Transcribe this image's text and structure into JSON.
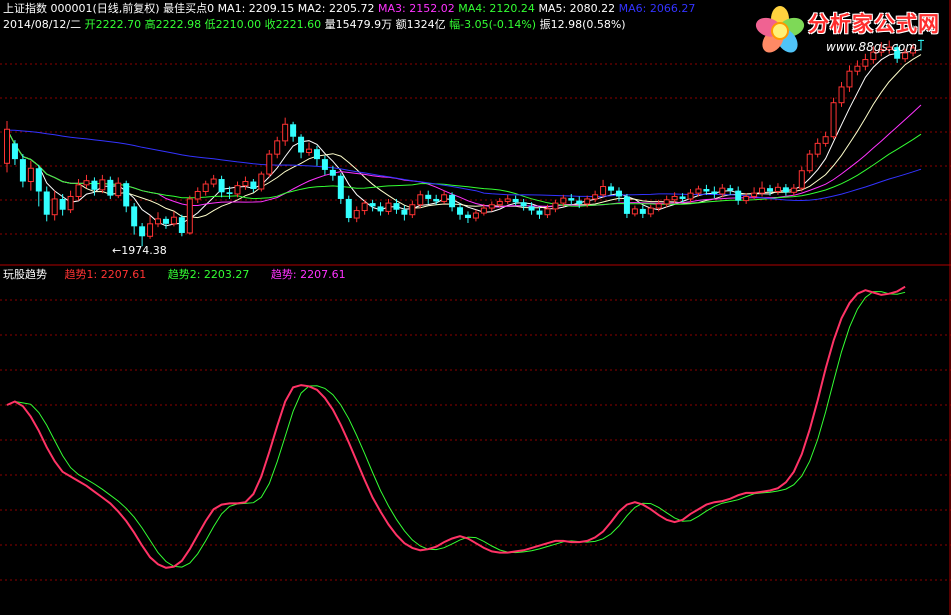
{
  "header": {
    "line1": [
      {
        "text": "上证指数 000001(日线,前复权) 最佳买点0",
        "color": "#ffffff"
      },
      {
        "text": "MA1: 2209.15",
        "color": "#ffffff"
      },
      {
        "text": "MA2: 2205.72",
        "color": "#ffffff"
      },
      {
        "text": "MA3: 2152.02",
        "color": "#ff33ff"
      },
      {
        "text": "MA4: 2120.24",
        "color": "#33ff33"
      },
      {
        "text": "MA5: 2080.22",
        "color": "#ffffff"
      },
      {
        "text": "MA6: 2066.27",
        "color": "#3333ff"
      }
    ],
    "line2": [
      {
        "text": "2014/08/12/二",
        "color": "#ffffff"
      },
      {
        "text": "开2222.70",
        "color": "#33ff33"
      },
      {
        "text": "高2222.98",
        "color": "#33ff33"
      },
      {
        "text": "低2210.00",
        "color": "#33ff33"
      },
      {
        "text": "收2221.60",
        "color": "#33ff33"
      },
      {
        "text": "量15479.9万",
        "color": "#ffffff"
      },
      {
        "text": "额1324亿",
        "color": "#ffffff"
      },
      {
        "text": "幅-3.05(-0.14%)",
        "color": "#33ff33"
      },
      {
        "text": "振12.98(0.58%)",
        "color": "#ffffff"
      }
    ]
  },
  "low_label": "1974.38",
  "indicator": {
    "name": "玩股趋势",
    "labels": [
      {
        "text": "趋势1: 2207.61",
        "color": "#ff3333"
      },
      {
        "text": "趋势2: 2203.27",
        "color": "#33ff33"
      },
      {
        "text": "趋势: 2207.61",
        "color": "#ff33ff"
      }
    ]
  },
  "logo": {
    "title": "分析家公式网",
    "url": "www.88gs.com"
  },
  "colors": {
    "up": "#ff3333",
    "down": "#33ffff",
    "grid": "#8b0000",
    "divider": "#b00000"
  },
  "chart_data": {
    "type": "candlestick",
    "price_range": [
      1955,
      2225
    ],
    "candles": [
      [
        2074,
        2115,
        2125,
        2063
      ],
      [
        2098,
        2079,
        2102,
        2072
      ],
      [
        2079,
        2052,
        2085,
        2045
      ],
      [
        2052,
        2068,
        2077,
        2041
      ],
      [
        2068,
        2040,
        2072,
        2022
      ],
      [
        2040,
        2012,
        2046,
        2004
      ],
      [
        2012,
        2031,
        2041,
        2005
      ],
      [
        2031,
        2018,
        2037,
        2011
      ],
      [
        2018,
        2034,
        2041,
        2014
      ],
      [
        2034,
        2048,
        2055,
        2029
      ],
      [
        2048,
        2053,
        2060,
        2044
      ],
      [
        2053,
        2042,
        2057,
        2035
      ],
      [
        2042,
        2054,
        2060,
        2038
      ],
      [
        2054,
        2035,
        2058,
        2031
      ],
      [
        2035,
        2050,
        2057,
        2032
      ],
      [
        2050,
        2022,
        2053,
        2015
      ],
      [
        2022,
        1998,
        2026,
        1988
      ],
      [
        1998,
        1986,
        2002,
        1974
      ],
      [
        1986,
        2001,
        2011,
        1983
      ],
      [
        2001,
        2007,
        2015,
        1997
      ],
      [
        2007,
        2001,
        2010,
        1995
      ],
      [
        2001,
        2009,
        2016,
        1998
      ],
      [
        2009,
        1990,
        2012,
        1986
      ],
      [
        1990,
        2031,
        2035,
        1988
      ],
      [
        2031,
        2040,
        2045,
        2026
      ],
      [
        2040,
        2049,
        2053,
        2035
      ],
      [
        2049,
        2055,
        2060,
        2045
      ],
      [
        2055,
        2039,
        2059,
        2033
      ],
      [
        2039,
        2037,
        2046,
        2031
      ],
      [
        2037,
        2047,
        2052,
        2033
      ],
      [
        2047,
        2052,
        2058,
        2042
      ],
      [
        2052,
        2043,
        2055,
        2039
      ],
      [
        2043,
        2061,
        2064,
        2040
      ],
      [
        2061,
        2085,
        2090,
        2057
      ],
      [
        2085,
        2101,
        2106,
        2080
      ],
      [
        2101,
        2121,
        2129,
        2095
      ],
      [
        2121,
        2106,
        2124,
        2100
      ],
      [
        2106,
        2087,
        2109,
        2080
      ],
      [
        2087,
        2091,
        2099,
        2083
      ],
      [
        2091,
        2079,
        2095,
        2071
      ],
      [
        2079,
        2066,
        2083,
        2060
      ],
      [
        2066,
        2059,
        2071,
        2053
      ],
      [
        2059,
        2031,
        2062,
        2025
      ],
      [
        2031,
        2008,
        2035,
        2003
      ],
      [
        2008,
        2017,
        2022,
        2003
      ],
      [
        2017,
        2026,
        2030,
        2012
      ],
      [
        2026,
        2022,
        2030,
        2016
      ],
      [
        2022,
        2016,
        2027,
        2011
      ],
      [
        2016,
        2026,
        2031,
        2012
      ],
      [
        2026,
        2018,
        2031,
        2013
      ],
      [
        2018,
        2012,
        2023,
        2005
      ],
      [
        2012,
        2024,
        2029,
        2008
      ],
      [
        2024,
        2036,
        2041,
        2020
      ],
      [
        2036,
        2031,
        2041,
        2025
      ],
      [
        2031,
        2028,
        2036,
        2024
      ],
      [
        2028,
        2036,
        2041,
        2025
      ],
      [
        2036,
        2021,
        2039,
        2016
      ],
      [
        2021,
        2012,
        2025,
        2006
      ],
      [
        2012,
        2008,
        2016,
        2002
      ],
      [
        2008,
        2014,
        2018,
        2004
      ],
      [
        2014,
        2020,
        2025,
        2011
      ],
      [
        2020,
        2024,
        2028,
        2016
      ],
      [
        2024,
        2028,
        2032,
        2021
      ],
      [
        2028,
        2031,
        2036,
        2025
      ],
      [
        2031,
        2027,
        2035,
        2023
      ],
      [
        2027,
        2022,
        2031,
        2017
      ],
      [
        2022,
        2017,
        2027,
        2012
      ],
      [
        2017,
        2012,
        2021,
        2007
      ],
      [
        2012,
        2019,
        2024,
        2008
      ],
      [
        2019,
        2026,
        2030,
        2015
      ],
      [
        2026,
        2032,
        2036,
        2022
      ],
      [
        2032,
        2029,
        2037,
        2024
      ],
      [
        2029,
        2025,
        2034,
        2020
      ],
      [
        2025,
        2031,
        2035,
        2021
      ],
      [
        2031,
        2036,
        2041,
        2027
      ],
      [
        2036,
        2046,
        2054,
        2033
      ],
      [
        2046,
        2041,
        2050,
        2036
      ],
      [
        2041,
        2034,
        2045,
        2028
      ],
      [
        2034,
        2013,
        2037,
        2008
      ],
      [
        2013,
        2019,
        2023,
        2010
      ],
      [
        2019,
        2013,
        2023,
        2008
      ],
      [
        2013,
        2020,
        2024,
        2009
      ],
      [
        2020,
        2025,
        2030,
        2016
      ],
      [
        2025,
        2030,
        2035,
        2021
      ],
      [
        2030,
        2034,
        2039,
        2026
      ],
      [
        2034,
        2031,
        2038,
        2027
      ],
      [
        2031,
        2038,
        2043,
        2027
      ],
      [
        2038,
        2043,
        2047,
        2034
      ],
      [
        2043,
        2040,
        2048,
        2036
      ],
      [
        2040,
        2037,
        2046,
        2032
      ],
      [
        2037,
        2044,
        2049,
        2033
      ],
      [
        2044,
        2041,
        2048,
        2036
      ],
      [
        2041,
        2029,
        2046,
        2024
      ],
      [
        2029,
        2034,
        2038,
        2025
      ],
      [
        2034,
        2038,
        2045,
        2031
      ],
      [
        2038,
        2044,
        2052,
        2034
      ],
      [
        2044,
        2040,
        2048,
        2035
      ],
      [
        2040,
        2045,
        2050,
        2036
      ],
      [
        2045,
        2039,
        2049,
        2035
      ],
      [
        2039,
        2044,
        2049,
        2035
      ],
      [
        2044,
        2065,
        2070,
        2040
      ],
      [
        2065,
        2085,
        2090,
        2062
      ],
      [
        2085,
        2098,
        2104,
        2081
      ],
      [
        2098,
        2106,
        2112,
        2094
      ],
      [
        2106,
        2147,
        2153,
        2103
      ],
      [
        2147,
        2166,
        2172,
        2142
      ],
      [
        2166,
        2185,
        2192,
        2160
      ],
      [
        2185,
        2191,
        2198,
        2180
      ],
      [
        2191,
        2199,
        2206,
        2186
      ],
      [
        2199,
        2208,
        2215,
        2194
      ],
      [
        2208,
        2211,
        2220,
        2203
      ],
      [
        2211,
        2214,
        2222,
        2206
      ],
      [
        2214,
        2200,
        2218,
        2195
      ],
      [
        2200,
        2207,
        2212,
        2196
      ],
      [
        2207,
        2213,
        2218,
        2203
      ],
      [
        2222.7,
        2221.6,
        2222.98,
        2210.0
      ]
    ],
    "ma": [
      {
        "name": "MA1",
        "period": 5,
        "color": "#ffffff"
      },
      {
        "name": "MA2",
        "period": 10,
        "color": "#ffffcc"
      },
      {
        "name": "MA3",
        "period": 20,
        "color": "#ff33ff"
      },
      {
        "name": "MA4",
        "period": 30,
        "color": "#33ff33"
      },
      {
        "name": "MA6",
        "period": 60,
        "color": "#3333ff"
      }
    ],
    "ma6_start": 2114,
    "low_point": 1974.38,
    "indicator_range": [
      1950,
      2230
    ],
    "trend1": [
      2125,
      2128,
      2124,
      2115,
      2103,
      2089,
      2077,
      2068,
      2064,
      2060,
      2056,
      2051,
      2046,
      2041,
      2034,
      2026,
      2016,
      2005,
      1995,
      1989,
      1986,
      1987,
      1992,
      2002,
      2014,
      2026,
      2036,
      2040,
      2041,
      2041,
      2042,
      2049,
      2064,
      2085,
      2107,
      2128,
      2140,
      2142,
      2141,
      2138,
      2131,
      2121,
      2108,
      2093,
      2077,
      2061,
      2046,
      2034,
      2023,
      2014,
      2007,
      2003,
      2001,
      2002,
      2004,
      2008,
      2011,
      2013,
      2011,
      2007,
      2003,
      2000,
      1999,
      1999,
      2000,
      2001,
      2003,
      2005,
      2007,
      2009,
      2009,
      2008,
      2008,
      2009,
      2012,
      2017,
      2025,
      2034,
      2040,
      2042,
      2040,
      2036,
      2031,
      2027,
      2025,
      2027,
      2032,
      2036,
      2040,
      2042,
      2043,
      2045,
      2048,
      2050,
      2050,
      2051,
      2052,
      2054,
      2059,
      2068,
      2083,
      2104,
      2129,
      2156,
      2180,
      2199,
      2212,
      2220,
      2223,
      2221,
      2219,
      2220,
      2222,
      2226
    ]
  }
}
